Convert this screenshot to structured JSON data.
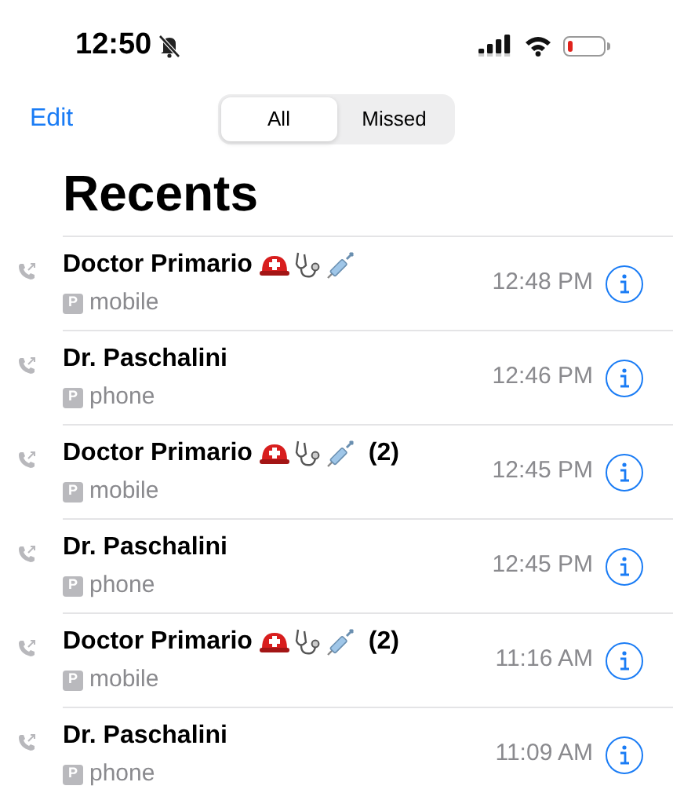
{
  "status_bar": {
    "time": "12:50",
    "silent": true
  },
  "nav": {
    "edit": "Edit",
    "segments": [
      {
        "label": "All",
        "selected": true
      },
      {
        "label": "Missed",
        "selected": false
      }
    ]
  },
  "title": "Recents",
  "calls": [
    {
      "name": "Doctor Primario",
      "emoji": true,
      "badge": "P",
      "label": "mobile",
      "time": "12:48 PM"
    },
    {
      "name": "Dr. Paschalini",
      "emoji": false,
      "badge": "P",
      "label": "phone",
      "time": "12:46 PM"
    },
    {
      "name": "Doctor Primario",
      "emoji": true,
      "count": "(2)",
      "badge": "P",
      "label": "mobile",
      "time": "12:45 PM"
    },
    {
      "name": "Dr. Paschalini",
      "emoji": false,
      "badge": "P",
      "label": "phone",
      "time": "12:45 PM"
    },
    {
      "name": "Doctor Primario",
      "emoji": true,
      "count": "(2)",
      "badge": "P",
      "label": "mobile",
      "time": "11:16 AM"
    },
    {
      "name": "Dr. Paschalini",
      "emoji": false,
      "badge": "P",
      "label": "phone",
      "time": "11:09 AM"
    }
  ]
}
